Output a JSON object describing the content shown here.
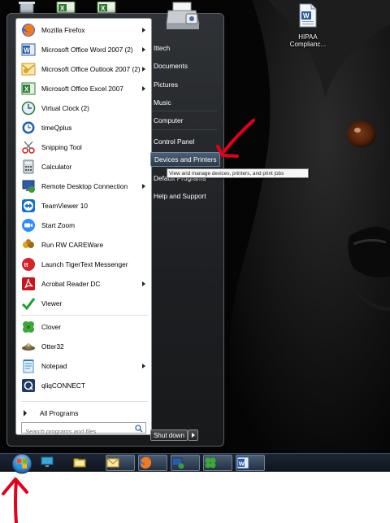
{
  "desktop": {
    "icons": [
      {
        "name": "word-doc-icon",
        "label": "HIPAA Complianc..."
      }
    ]
  },
  "start_menu": {
    "programs": [
      {
        "label": "Mozilla Firefox",
        "icon": "firefox-icon",
        "submenu": true
      },
      {
        "label": "Microsoft Office Word 2007 (2)",
        "icon": "word-icon",
        "submenu": true
      },
      {
        "label": "Microsoft Office Outlook 2007 (2)",
        "icon": "outlook-icon",
        "submenu": true
      },
      {
        "label": "Microsoft Office Excel 2007",
        "icon": "excel-icon",
        "submenu": true
      },
      {
        "label": "Virtual Clock (2)",
        "icon": "clock-icon",
        "submenu": false
      },
      {
        "label": "timeQplus",
        "icon": "clock-icon",
        "submenu": false
      },
      {
        "label": "Snipping Tool",
        "icon": "scissors-icon",
        "submenu": false
      },
      {
        "label": "Calculator",
        "icon": "calculator-icon",
        "submenu": false
      },
      {
        "label": "Remote Desktop Connection",
        "icon": "remote-desktop-icon",
        "submenu": true
      },
      {
        "label": "TeamViewer 10",
        "icon": "teamviewer-icon",
        "submenu": false
      },
      {
        "label": "Start Zoom",
        "icon": "zoom-icon",
        "submenu": false
      },
      {
        "label": "Run RW CAREWare",
        "icon": "careware-icon",
        "submenu": false
      },
      {
        "label": "Launch TigerText Messenger",
        "icon": "tigertext-icon",
        "submenu": false
      },
      {
        "label": "Acrobat Reader DC",
        "icon": "acrobat-icon",
        "submenu": true
      },
      {
        "label": "Viewer",
        "icon": "viewer-check-icon",
        "submenu": false
      },
      {
        "label": "Clover",
        "icon": "clover-icon",
        "submenu": false
      },
      {
        "label": "Otter32",
        "icon": "otter-icon",
        "submenu": false
      },
      {
        "label": "Notepad",
        "icon": "notepad-icon",
        "submenu": true
      },
      {
        "label": "qliqCONNECT",
        "icon": "qliq-icon",
        "submenu": false
      }
    ],
    "all_programs": "All Programs",
    "search_placeholder": "Search programs and files",
    "right_items": [
      {
        "label": "Ittech"
      },
      {
        "label": "Documents"
      },
      {
        "label": "Pictures"
      },
      {
        "label": "Music"
      },
      {
        "label": "Computer"
      },
      {
        "label": "Control Panel"
      },
      {
        "label": "Devices and Printers"
      },
      {
        "label": "Default Programs"
      },
      {
        "label": "Help and Support"
      }
    ],
    "hovered_item": "Devices and Printers",
    "tooltip": "View and manage devices, printers, and print jobs",
    "shutdown_label": "Shut down"
  },
  "taskbar": {
    "pinned": [
      {
        "name": "monitor-icon"
      },
      {
        "name": "file-explorer-icon"
      },
      {
        "name": "outlook-icon"
      },
      {
        "name": "firefox-icon"
      },
      {
        "name": "remote-desktop-icon"
      },
      {
        "name": "clover-icon"
      },
      {
        "name": "word-icon"
      }
    ]
  },
  "colors": {
    "annotation_arrow": "#e3001b",
    "start_menu_bg": "#1d1f22",
    "taskbar_bg": "#141c26"
  }
}
